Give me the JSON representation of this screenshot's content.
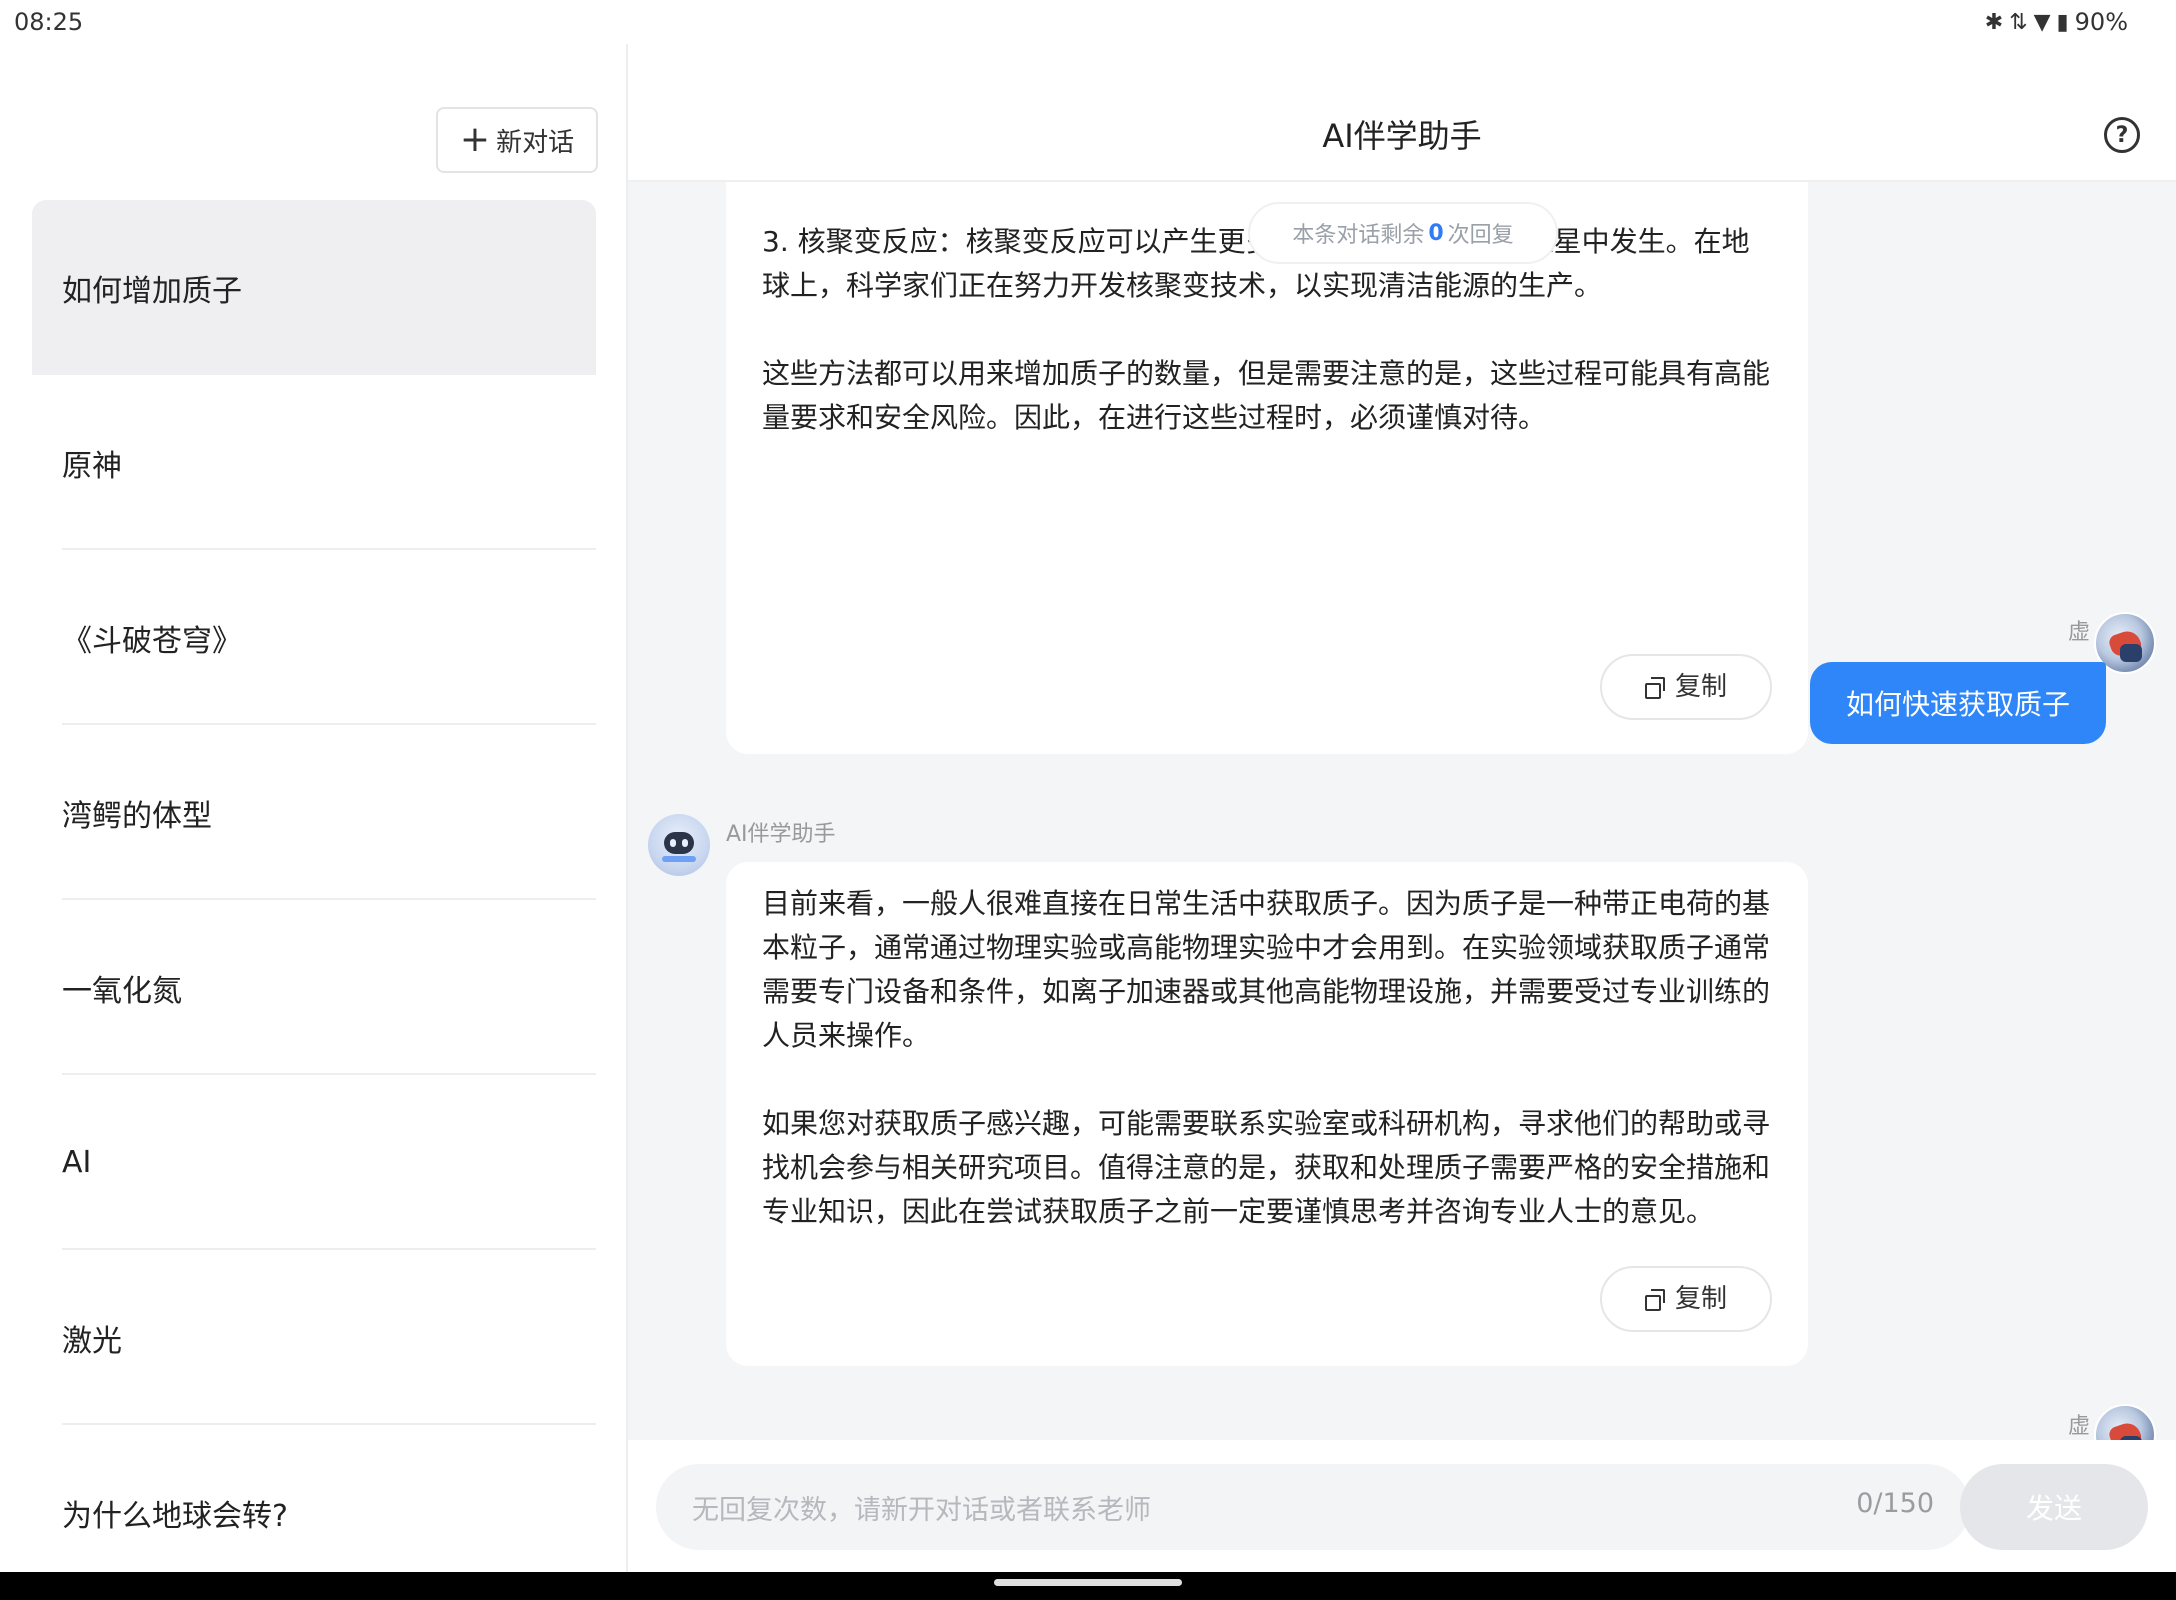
{
  "status_bar": {
    "time": "08:25",
    "battery": "90%",
    "icons": [
      "bluetooth-icon",
      "signal-icon",
      "wifi-icon",
      "battery-icon"
    ]
  },
  "sidebar": {
    "new_chat_label": "新对话",
    "conversations": [
      {
        "label": "如何增加质子",
        "active": true
      },
      {
        "label": "原神",
        "active": false
      },
      {
        "label": "《斗破苍穹》",
        "active": false
      },
      {
        "label": "湾鳄的体型",
        "active": false
      },
      {
        "label": "一氧化氮",
        "active": false
      },
      {
        "label": "AI",
        "active": false
      },
      {
        "label": "激光",
        "active": false
      },
      {
        "label": "为什么地球会转?",
        "active": false
      }
    ]
  },
  "header": {
    "title": "AI伴学助手"
  },
  "chat": {
    "remaining": {
      "prefix": "本条对话剩余",
      "count": "0",
      "suffix": "次回复"
    },
    "messages": [
      {
        "role": "ai",
        "paragraphs": [
          "3. 核聚变反应：核聚变反应可以产生更多质子，例如在太阳和恒星中发生。在地球上，科学家们正在努力开发核聚变技术，以实现清洁能源的生产。",
          "这些方法都可以用来增加质子的数量，但是需要注意的是，这些过程可能具有高能量要求和安全风险。因此，在进行这些过程时，必须谨慎对待。"
        ],
        "copy_label": "复制"
      },
      {
        "role": "user",
        "name": "虚",
        "text": "如何快速获取质子"
      },
      {
        "role": "ai",
        "name": "AI伴学助手",
        "paragraphs": [
          "目前来看，一般人很难直接在日常生活中获取质子。因为质子是一种带正电荷的基本粒子，通常通过物理实验或高能物理实验中才会用到。在实验领域获取质子通常需要专门设备和条件，如离子加速器或其他高能物理设施，并需要受过专业训练的人员来操作。",
          "如果您对获取质子感兴趣，可能需要联系实验室或科研机构，寻求他们的帮助或寻找机会参与相关研究项目。值得注意的是，获取和处理质子需要严格的安全措施和专业知识，因此在尝试获取质子之前一定要谨慎思考并咨询专业人士的意见。"
        ],
        "copy_label": "复制"
      },
      {
        "role": "user",
        "name": "虚"
      }
    ]
  },
  "input": {
    "placeholder": "无回复次数，请新开对话或者联系老师",
    "counter": "0/150",
    "send_label": "发送"
  }
}
